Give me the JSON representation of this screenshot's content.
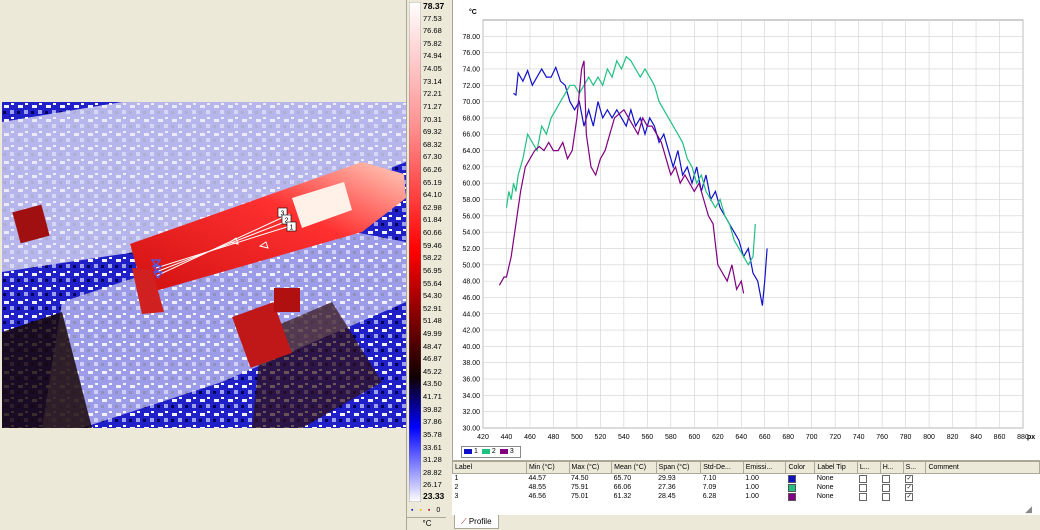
{
  "scale": {
    "unit": "°C",
    "ticks": [
      "78.37",
      "77.53",
      "76.68",
      "75.82",
      "74.94",
      "74.05",
      "73.14",
      "72.21",
      "71.27",
      "70.31",
      "69.32",
      "68.32",
      "67.30",
      "66.26",
      "65.19",
      "64.10",
      "62.98",
      "61.84",
      "60.66",
      "59.46",
      "58.22",
      "56.95",
      "55.64",
      "54.30",
      "52.91",
      "51.48",
      "49.99",
      "48.47",
      "46.87",
      "45.22",
      "43.50",
      "41.71",
      "39.82",
      "37.86",
      "35.78",
      "33.61",
      "31.28",
      "28.82",
      "26.17",
      "23.33"
    ],
    "icon_value": "0"
  },
  "chart_data": {
    "type": "line",
    "ylabel": "°C",
    "xlabel": "px",
    "ylim": [
      30,
      80
    ],
    "xlim": [
      420,
      880
    ],
    "yticks": [
      "30.00",
      "32.00",
      "34.00",
      "36.00",
      "38.00",
      "40.00",
      "42.00",
      "44.00",
      "46.00",
      "48.00",
      "50.00",
      "52.00",
      "54.00",
      "56.00",
      "58.00",
      "60.00",
      "62.00",
      "64.00",
      "66.00",
      "68.00",
      "70.00",
      "72.00",
      "74.00",
      "76.00",
      "78.00"
    ],
    "xticks": [
      "420",
      "440",
      "460",
      "480",
      "500",
      "520",
      "540",
      "560",
      "580",
      "600",
      "620",
      "640",
      "660",
      "680",
      "700",
      "720",
      "740",
      "760",
      "780",
      "800",
      "820",
      "840",
      "860",
      "880"
    ],
    "series": [
      {
        "name": "1",
        "color": "#1010c8",
        "x": [
          446,
          448,
          450,
          454,
          458,
          462,
          466,
          470,
          474,
          478,
          482,
          486,
          490,
          494,
          498,
          502,
          506,
          510,
          514,
          518,
          522,
          526,
          530,
          534,
          538,
          542,
          546,
          550,
          554,
          558,
          562,
          566,
          570,
          574,
          578,
          582,
          586,
          590,
          594,
          598,
          602,
          606,
          610,
          614,
          618,
          622,
          626,
          630,
          634,
          638,
          642,
          646,
          650,
          654,
          658,
          660,
          662
        ],
        "y": [
          71,
          70.8,
          73.5,
          72.5,
          73.8,
          72,
          73,
          74,
          73,
          73,
          74.2,
          72.5,
          72,
          70,
          69,
          70,
          67,
          69,
          67,
          70,
          68,
          69,
          68,
          69,
          68,
          67,
          69,
          67,
          68,
          66,
          68,
          67,
          65,
          66,
          64,
          62,
          64,
          61,
          62,
          60,
          62,
          59,
          61,
          58,
          59,
          57,
          56,
          55,
          54,
          53,
          51,
          52,
          49,
          48,
          45,
          48,
          52
        ]
      },
      {
        "name": "2",
        "color": "#20c080",
        "x": [
          440,
          442,
          444,
          446,
          448,
          450,
          454,
          458,
          462,
          466,
          470,
          474,
          478,
          482,
          486,
          490,
          494,
          498,
          502,
          506,
          510,
          514,
          518,
          522,
          526,
          530,
          534,
          538,
          542,
          546,
          550,
          554,
          558,
          562,
          566,
          570,
          574,
          578,
          582,
          586,
          590,
          594,
          598,
          602,
          606,
          610,
          614,
          618,
          622,
          626,
          630,
          634,
          638,
          642,
          646,
          650,
          652
        ],
        "y": [
          57,
          59,
          58,
          60,
          59,
          61,
          63,
          66,
          65,
          64,
          67,
          66,
          68,
          69,
          70,
          71,
          72,
          72,
          71,
          72,
          73,
          72,
          73,
          72,
          74,
          73,
          75,
          74,
          75.5,
          75,
          74,
          73,
          74,
          73,
          72,
          70,
          69,
          68,
          67,
          66,
          65,
          63,
          62,
          60,
          61,
          59,
          58,
          57,
          58,
          56,
          55,
          53,
          52,
          51,
          50,
          51,
          55
        ]
      },
      {
        "name": "3",
        "color": "#800080",
        "x": [
          434,
          436,
          438,
          440,
          444,
          448,
          452,
          456,
          460,
          464,
          468,
          472,
          476,
          480,
          484,
          488,
          492,
          496,
          500,
          504,
          506,
          508,
          512,
          516,
          520,
          524,
          528,
          532,
          536,
          540,
          544,
          548,
          552,
          556,
          560,
          564,
          568,
          572,
          576,
          580,
          584,
          588,
          592,
          596,
          600,
          604,
          608,
          612,
          616,
          620,
          624,
          628,
          632,
          636,
          640,
          642
        ],
        "y": [
          47.5,
          48,
          48.5,
          48.5,
          51,
          55,
          59,
          62,
          63,
          64,
          64.5,
          64,
          65,
          64,
          64,
          65,
          63,
          64,
          68,
          74,
          75,
          66,
          62,
          61,
          63,
          64,
          66,
          68,
          68.5,
          69,
          68,
          67,
          66,
          68,
          67,
          67,
          66,
          65,
          63,
          61,
          62,
          60,
          61,
          60,
          59,
          60,
          58,
          56,
          55,
          50,
          49,
          48,
          50,
          47,
          48,
          46.5
        ]
      }
    ]
  },
  "legend": [
    "1",
    "2",
    "3"
  ],
  "table": {
    "headers": [
      "Label",
      "Min (°C)",
      "Max (°C)",
      "Mean (°C)",
      "Span (°C)",
      "Std-De...",
      "Emissi...",
      "Color",
      "Label Tip",
      "L...",
      "H...",
      "S...",
      "Comment"
    ],
    "rows": [
      {
        "label": "1",
        "min": "44.57",
        "max": "74.50",
        "mean": "65.70",
        "span": "29.93",
        "std": "7.10",
        "emis": "1.00",
        "color": "#1010c8",
        "tip": "None",
        "l": "",
        "h": "",
        "s": "✓",
        "comment": ""
      },
      {
        "label": "2",
        "min": "48.55",
        "max": "75.91",
        "mean": "66.06",
        "span": "27.36",
        "std": "7.09",
        "emis": "1.00",
        "color": "#20c080",
        "tip": "None",
        "l": "",
        "h": "",
        "s": "✓",
        "comment": ""
      },
      {
        "label": "3",
        "min": "46.56",
        "max": "75.01",
        "mean": "61.32",
        "span": "28.45",
        "std": "6.28",
        "emis": "1.00",
        "color": "#800080",
        "tip": "None",
        "l": "",
        "h": "",
        "s": "✓",
        "comment": ""
      }
    ]
  },
  "tab": {
    "label": "Profile"
  },
  "markers": [
    "3",
    "2",
    "1"
  ]
}
